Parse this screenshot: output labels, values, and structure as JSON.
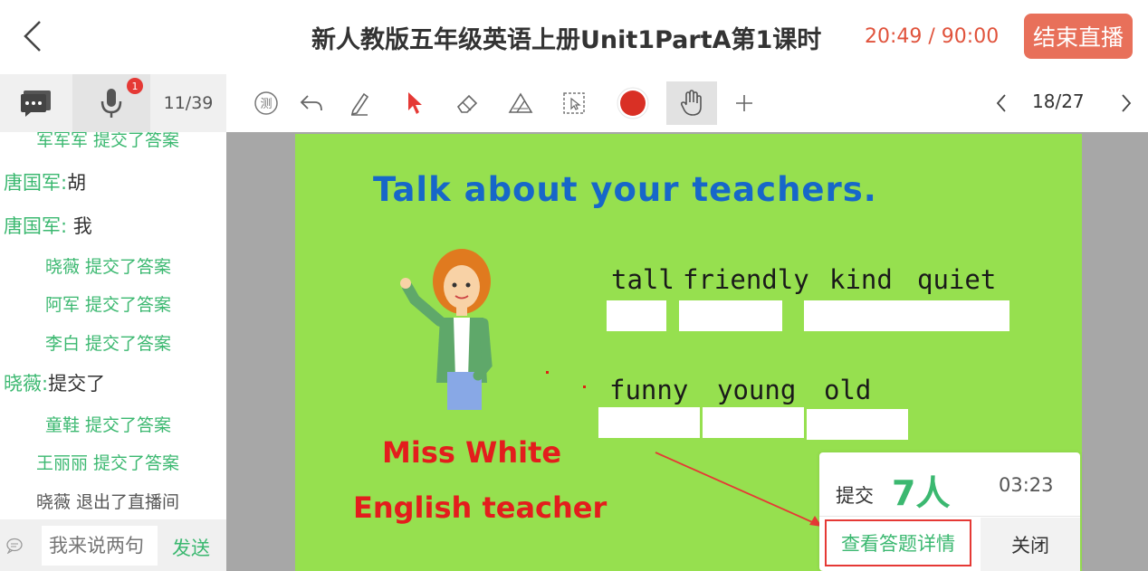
{
  "header": {
    "title": "新人教版五年级英语上册Unit1PartA第1课时",
    "timer": "20:49 / 90:00",
    "end_label": "结束直播"
  },
  "toolbar": {
    "mic_badge": "1",
    "viewer_count": "11/39",
    "page_indicator": "18/27",
    "pen_color": "#d93025",
    "tools": [
      "test-icon",
      "undo-icon",
      "pencil-icon",
      "pointer-icon",
      "eraser-icon",
      "ruler-icon",
      "select-icon",
      "color-icon",
      "hand-icon",
      "plus-icon"
    ]
  },
  "chat": {
    "messages": [
      {
        "type": "system",
        "text": "军军军 提交了答案"
      },
      {
        "type": "user",
        "name": "唐国军:",
        "text": "胡"
      },
      {
        "type": "user",
        "name": "唐国军:",
        "text": " 我"
      },
      {
        "type": "system",
        "text": "晓薇 提交了答案"
      },
      {
        "type": "system",
        "text": "阿军 提交了答案"
      },
      {
        "type": "system",
        "text": "李白 提交了答案"
      },
      {
        "type": "user",
        "name": "晓薇:",
        "text": "提交了"
      },
      {
        "type": "system",
        "text": "童鞋 提交了答案"
      },
      {
        "type": "system",
        "text": "王丽丽 提交了答案"
      },
      {
        "type": "system-gray",
        "text": "晓薇 退出了直播间"
      }
    ],
    "input_placeholder": "我来说两句",
    "send_label": "发送"
  },
  "slide": {
    "title": "Talk about your teachers.",
    "words_row1": [
      "tall",
      "friendly",
      "kind",
      "quiet"
    ],
    "words_row2": [
      "funny",
      "young",
      "old"
    ],
    "caption_name": "Miss White",
    "caption_role": "English teacher"
  },
  "popup": {
    "label": "提交",
    "count": "7人",
    "time": "03:23",
    "detail_label": "查看答题详情",
    "close_label": "关闭"
  }
}
